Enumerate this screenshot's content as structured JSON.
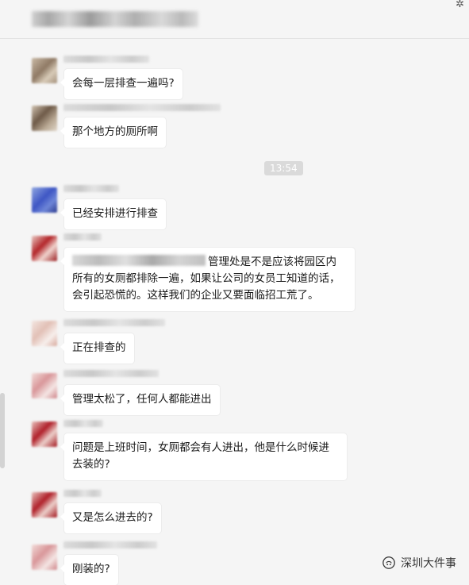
{
  "window": {
    "pin_icon": "pin-icon"
  },
  "time_separator": "13:54",
  "messages": [
    {
      "text": "会每一层排查一遍吗?"
    },
    {
      "text": "那个地方的厕所啊"
    },
    {
      "text": "已经安排进行排查"
    },
    {
      "text_line1": "管理处是不是应该将园区内所",
      "text_rest": "有的女厕都排除一遍，如果让公司的女员工知道的话，会引起恐慌的。这样我们的企业又要面临招工荒了。"
    },
    {
      "text": "正在排查的"
    },
    {
      "text": "管理太松了，任何人都能进出"
    },
    {
      "text": "问题是上班时间，女厕都会有人进出，他是什么时候进去装的?"
    },
    {
      "text": "又是怎么进去的?"
    },
    {
      "text": "刚装的?"
    }
  ],
  "watermark": {
    "text": "深圳大件事",
    "icon": "wechat-official-account-icon"
  }
}
